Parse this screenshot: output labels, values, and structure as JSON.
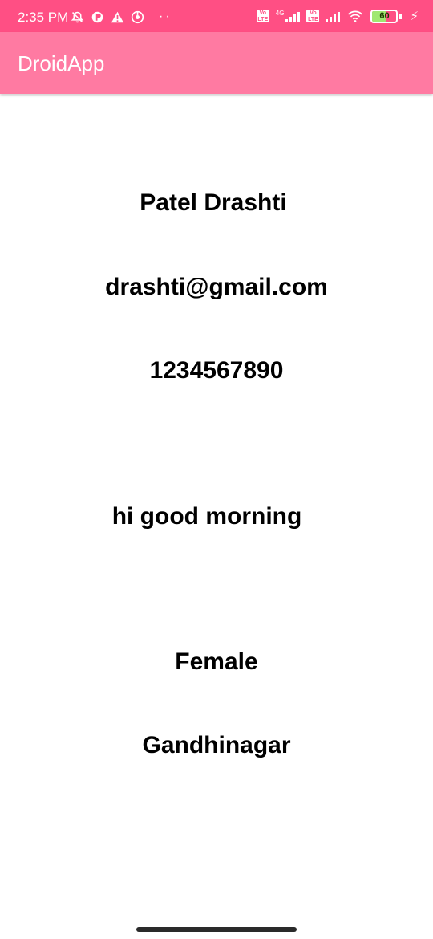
{
  "status_bar": {
    "time": "2:35 PM",
    "left_icons": [
      "bell-off-icon",
      "app-icon",
      "warning-icon",
      "chrome-icon"
    ],
    "more": "··",
    "sim1_badge": "Vo LTE",
    "network_type": "4G",
    "sim2_badge": "Vo LTE",
    "battery_level": "60",
    "charging": true,
    "colors": {
      "background": "#ff4f84",
      "battery_fill": "#9fe870"
    }
  },
  "app_bar": {
    "title": "DroidApp",
    "color": "#ff7aa2"
  },
  "content": {
    "name": "Patel Drashti",
    "email": "drashti@gmail.com",
    "phone": "1234567890",
    "message": "hi good morning",
    "gender": "Female",
    "city": "Gandhinagar"
  }
}
